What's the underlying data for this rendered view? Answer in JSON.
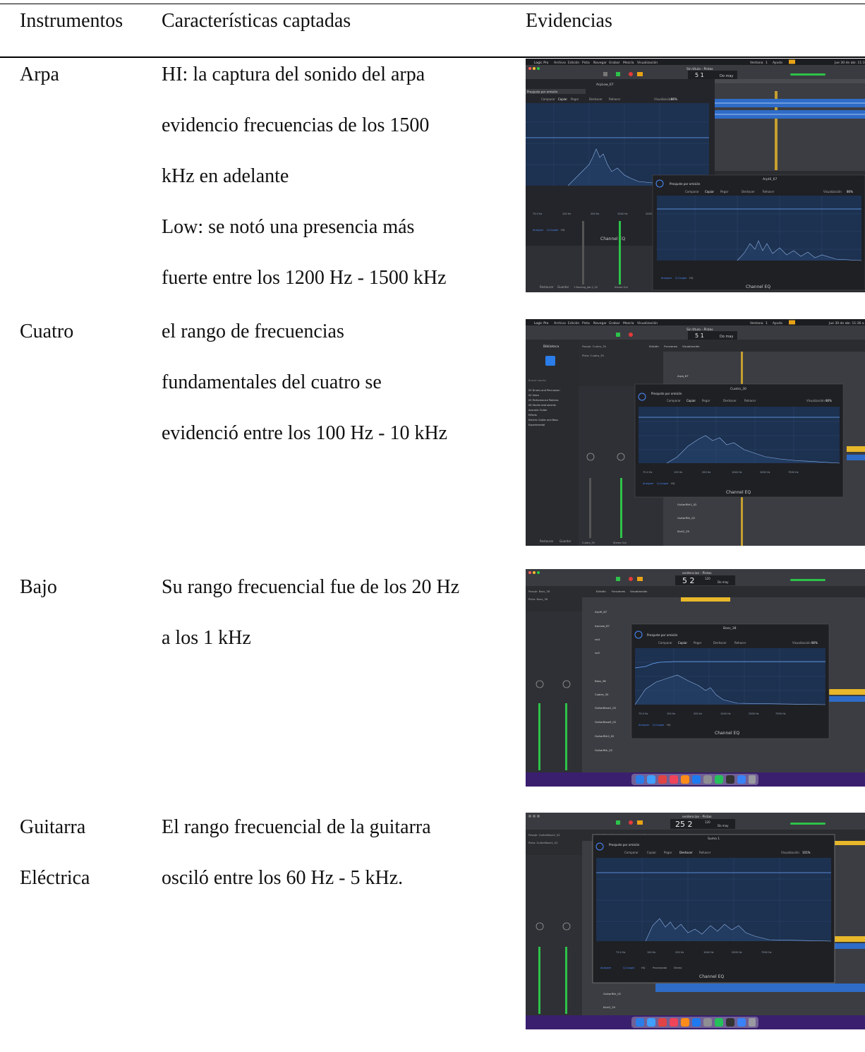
{
  "table": {
    "headers": [
      "Instrumentos",
      "Características captadas",
      "Evidencias"
    ],
    "rows": [
      {
        "instrument": [
          "Arpa"
        ],
        "features": [
          "HI: la captura del sonido del arpa",
          "evidencio  frecuencias de los  1500",
          "kHz en adelante",
          "Low: se notó una presencia más",
          "fuerte entre los 1200 Hz - 1500 kHz"
        ],
        "evidence": {
          "menu": [
            "Logic Pro",
            "Archivo",
            "Edición",
            "Pista",
            "Navegar",
            "Grabar",
            "Mezcla",
            "Visualización"
          ],
          "menu_right": [
            "Ventana",
            "1",
            "Ayuda",
            "Jue 30 de abr. 11:3"
          ],
          "window_title": "Sin título - Pistas",
          "lcd": "5  1",
          "lcd_key": "Do may",
          "eq_title": "ArpLow_67",
          "eq2_title": "ArpHi_67",
          "preset": "Preajuste por omisión",
          "edit_buttons": [
            "Comparar",
            "Copiar",
            "Pegar",
            "Deshacer",
            "Rehacer"
          ],
          "visual_label": "Visualización",
          "zoom": "86%",
          "freq_labels": [
            "20",
            "30",
            "40",
            "60",
            "80",
            "100",
            "200",
            "300",
            "400",
            "600",
            "800",
            "1k",
            "2k",
            "3k",
            "4k",
            "6k",
            "8k",
            "10k",
            "20k"
          ],
          "band_freqs": [
            "75.0 Hz",
            "100 Hz",
            "200 Hz",
            "1040 Hz",
            "2000 Hz",
            "7500 Hz"
          ],
          "footer_buttons": [
            "Analyzer",
            "Q-Couple",
            "HQ"
          ],
          "plugin_name": "Channel EQ",
          "bottom_left": [
            "Restaurar",
            "Guardar"
          ],
          "track_names": [
            "1 Backing_Jab 2_02",
            "Stereo Out"
          ]
        }
      },
      {
        "instrument": [
          "Cuatro"
        ],
        "features": [
          "el rango de frecuencias",
          "fundamentales del cuatro se",
          "evidenció entre los 100 Hz - 10 kHz"
        ],
        "evidence": {
          "menu": [
            "Logic Pro",
            "Archivo",
            "Edición",
            "Pista",
            "Navegar",
            "Grabar",
            "Mezcla",
            "Visualización"
          ],
          "menu_right": [
            "Ventana",
            "1",
            "Ayuda",
            "Jue 30 de abr. 11:36 a"
          ],
          "window_title": "Sin título - Pistas",
          "lcd": "5  1",
          "lcd_key": "Do may",
          "library_title": "Biblioteca",
          "library_items": [
            "Buscar sonido",
            "05 Drums and Percussion",
            "04 Voice",
            "05 Performance Patches",
            "06 Studio Instruments",
            "Acoustic Guitar",
            "Effects",
            "Electric Guitar and Bass",
            "Experimental"
          ],
          "region_label": "Pasaje: Cuatro_30",
          "track_label": "Pista: Cuatro_30",
          "toolbar": [
            "Edición",
            "Funciones",
            "Visualización"
          ],
          "eq_title": "Cuatro_30",
          "preset": "Preajuste por omisión",
          "edit_buttons": [
            "Comparar",
            "Copiar",
            "Pegar",
            "Deshacer",
            "Rehacer"
          ],
          "visual_label": "Visualización",
          "zoom": "86%",
          "freq_labels": [
            "20",
            "30",
            "40",
            "60",
            "80",
            "100",
            "200",
            "300",
            "400",
            "600",
            "800",
            "1k",
            "2k",
            "3k",
            "4k",
            "6k",
            "8k",
            "10k",
            "20k"
          ],
          "band_freqs": [
            "75.0 Hz",
            "100 Hz",
            "200 Hz",
            "1040 Hz",
            "2000 Hz",
            "7500 Hz"
          ],
          "footer_buttons": [
            "Analyzer",
            "Q-Couple",
            "HQ"
          ],
          "plugin_name": "Channel EQ",
          "tracks": [
            "Arpa_67",
            "GuitarRth1_02",
            "GuitarRth_02",
            "Kick2_29"
          ],
          "bottom_left": [
            "Restaurar",
            "Guardar"
          ],
          "strip_names": [
            "Cuatro_30",
            "Stereo Out"
          ]
        }
      },
      {
        "instrument": [
          "Bajo"
        ],
        "features": [
          "Su rango frecuencial fue de los 20 Hz",
          "a los 1 kHz"
        ],
        "evidence": {
          "window_title": "evidencias - Pistas",
          "lcd": "5 2",
          "lcd_tempo": "120",
          "lcd_key": "Do may",
          "region_label": "Pasaje: Bass_38",
          "track_label": "Pista: Bass_38",
          "toolbar": [
            "Edición",
            "Funciones",
            "Visualización"
          ],
          "eq_title": "Bass_38",
          "preset": "Preajuste por omisión",
          "edit_buttons": [
            "Comparar",
            "Copiar",
            "Pegar",
            "Deshacer",
            "Rehacer"
          ],
          "visual_label": "Visualización",
          "zoom": "86%",
          "freq_labels": [
            "20",
            "30",
            "40",
            "60",
            "80",
            "100",
            "200",
            "300",
            "400",
            "600",
            "800",
            "1k",
            "2k",
            "3k",
            "4k",
            "6k",
            "8k",
            "10k",
            "20k"
          ],
          "band_freqs": [
            "75.0 Hz",
            "100 Hz",
            "200 Hz",
            "1040 Hz",
            "2000 Hz",
            "7500 Hz"
          ],
          "footer_buttons": [
            "Analyzer",
            "Q-Couple",
            "HQ"
          ],
          "plugin_name": "Channel EQ",
          "tracks": [
            "ArpHi_67",
            "ArpLow_67",
            "vo4",
            "vo2",
            "Bass_38",
            "Cuatro_30",
            "GuitarBase1_02",
            "GuitarBase0_02",
            "GuitarRth2_02",
            "GuitarRth_02"
          ],
          "strip_names": [
            "Bass_38",
            "Stereo Out"
          ]
        }
      },
      {
        "instrument": [
          "Guitarra",
          "Eléctrica"
        ],
        "features": [
          "El rango frecuencial de la guitarra",
          "osciló entre los 60 Hz - 5 kHz."
        ],
        "evidence": {
          "window_title": "evidencias - Pistas",
          "lcd": "25 2",
          "lcd_tempo": "120",
          "lcd_key": "Do may",
          "region_label": "Pasaje: GuitarBase1_02",
          "track_label": "Pista: GuitarBase1_02",
          "toolbar": [
            "Edición",
            "Funciones",
            "Visualización"
          ],
          "eq_title": "Suma 1",
          "preset": "Preajuste por omisión",
          "edit_buttons": [
            "Comparar",
            "Copiar",
            "Pegar",
            "Deshacer",
            "Rehacer"
          ],
          "visual_label": "Visualización",
          "zoom": "101%",
          "freq_labels": [
            "20",
            "30",
            "40",
            "60",
            "80",
            "100",
            "200",
            "300",
            "400",
            "600",
            "800",
            "1k",
            "2k",
            "3k",
            "4k",
            "6k",
            "8k",
            "10k",
            "20k"
          ],
          "band_freqs": [
            "75.0 Hz",
            "100 Hz",
            "200 Hz",
            "1040 Hz",
            "2000 Hz",
            "7500 Hz"
          ],
          "footer_buttons": [
            "Analyzer",
            "Q-Couple",
            "HQ",
            "Procesando",
            "Stereo"
          ],
          "plugin_name": "Channel EQ",
          "tracks": [
            "GuitarRth_02",
            "Kick2_29"
          ],
          "strip_names": [
            "GuitarBase1_02",
            "Suma 1"
          ]
        }
      }
    ]
  }
}
